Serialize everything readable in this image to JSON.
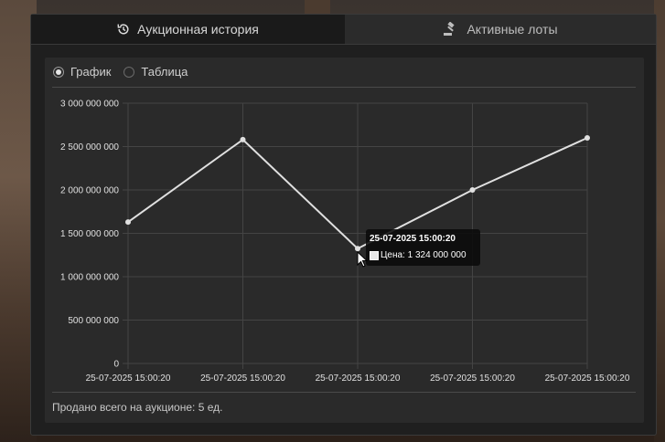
{
  "tabs": [
    {
      "label": "Аукционная история",
      "icon": "history-icon",
      "active": true
    },
    {
      "label": "Активные лоты",
      "icon": "gavel-icon",
      "active": false
    }
  ],
  "view_toggle": {
    "options": [
      {
        "label": "График",
        "selected": true
      },
      {
        "label": "Таблица",
        "selected": false
      }
    ]
  },
  "chart_data": {
    "type": "line",
    "categories": [
      "25-07-2025 15:00:20",
      "25-07-2025 15:00:20",
      "25-07-2025 15:00:20",
      "25-07-2025 15:00:20",
      "25-07-2025 15:00:20"
    ],
    "series": [
      {
        "values": [
          1630000000,
          2580000000,
          1324000000,
          2000000000,
          2600000000
        ]
      }
    ],
    "y_ticks": [
      "0",
      "500 000 000",
      "1 000 000 000",
      "1 500 000 000",
      "2 000 000 000",
      "2 500 000 000",
      "3 000 000 000"
    ],
    "ylim": [
      0,
      3000000000
    ],
    "grid": true,
    "line_color": "#e0e0e0",
    "tooltip": {
      "title": "25-07-2025 15:00:20",
      "row": "Цена: 1 324 000 000",
      "point_index": 2
    }
  },
  "footer": {
    "text": "Продано всего на аукционе: 5 ед."
  }
}
